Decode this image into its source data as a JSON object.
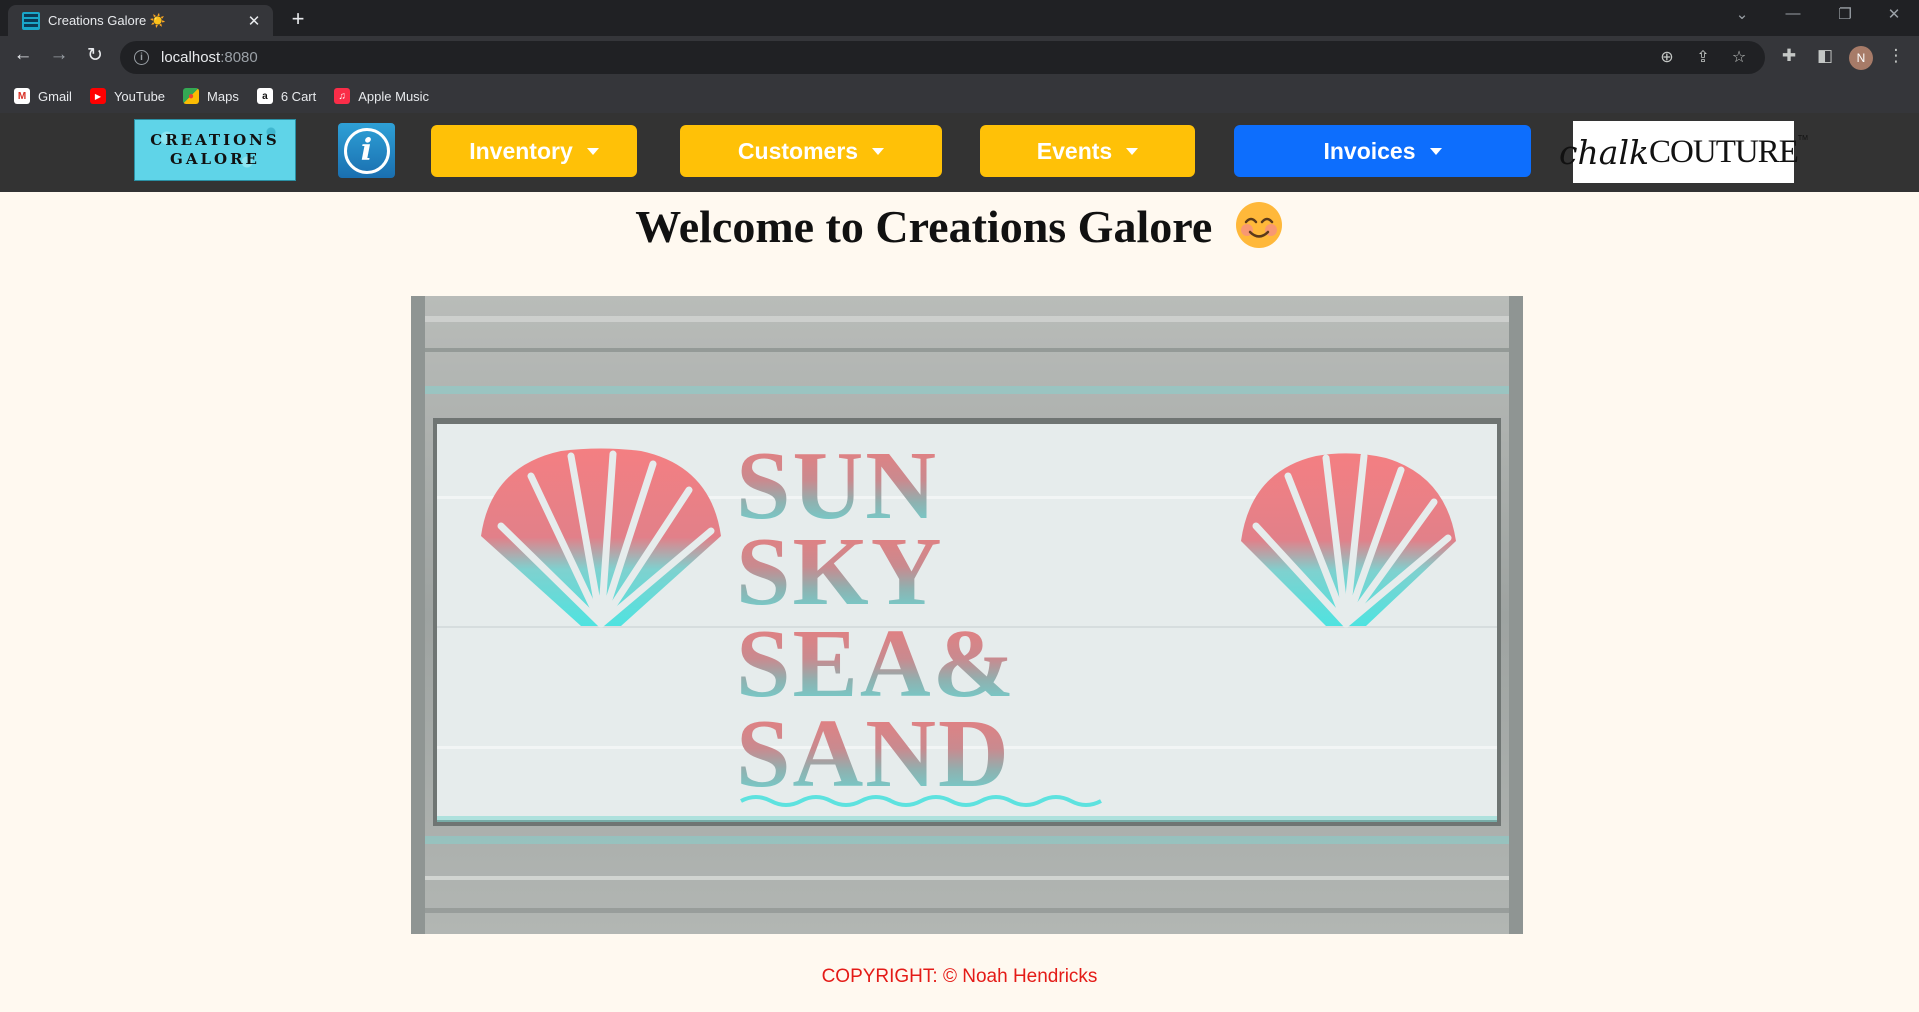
{
  "browser": {
    "tab_title": "Creations Galore ☀️",
    "url_host": "localhost",
    "url_port": ":8080",
    "avatar_letter": "N",
    "bookmarks": [
      {
        "label": "Gmail",
        "icon": "gmail-icon"
      },
      {
        "label": "YouTube",
        "icon": "youtube-icon"
      },
      {
        "label": "Maps",
        "icon": "maps-icon"
      },
      {
        "label": "6 Cart",
        "icon": "amazon-icon"
      },
      {
        "label": "Apple Music",
        "icon": "apple-music-icon"
      }
    ]
  },
  "nav": {
    "logo_line1": "CREATIONS",
    "logo_line2": "GALORE",
    "info_glyph": "i",
    "inventory": "Inventory",
    "customers": "Customers",
    "events": "Events",
    "invoices": "Invoices",
    "brand_script": "chalk",
    "brand_caps": "COUTURE",
    "brand_tm": "TM",
    "colors": {
      "dropdown": "#ffc107",
      "primary": "#0d6efd",
      "navbar": "#333333"
    }
  },
  "main": {
    "welcome": "Welcome to Creations Galore",
    "hero_words": [
      "SUN",
      "SKY",
      "SEA&",
      "SAND"
    ]
  },
  "footer": {
    "copyright": "COPYRIGHT: © Noah Hendricks",
    "color": "#e41b17"
  }
}
